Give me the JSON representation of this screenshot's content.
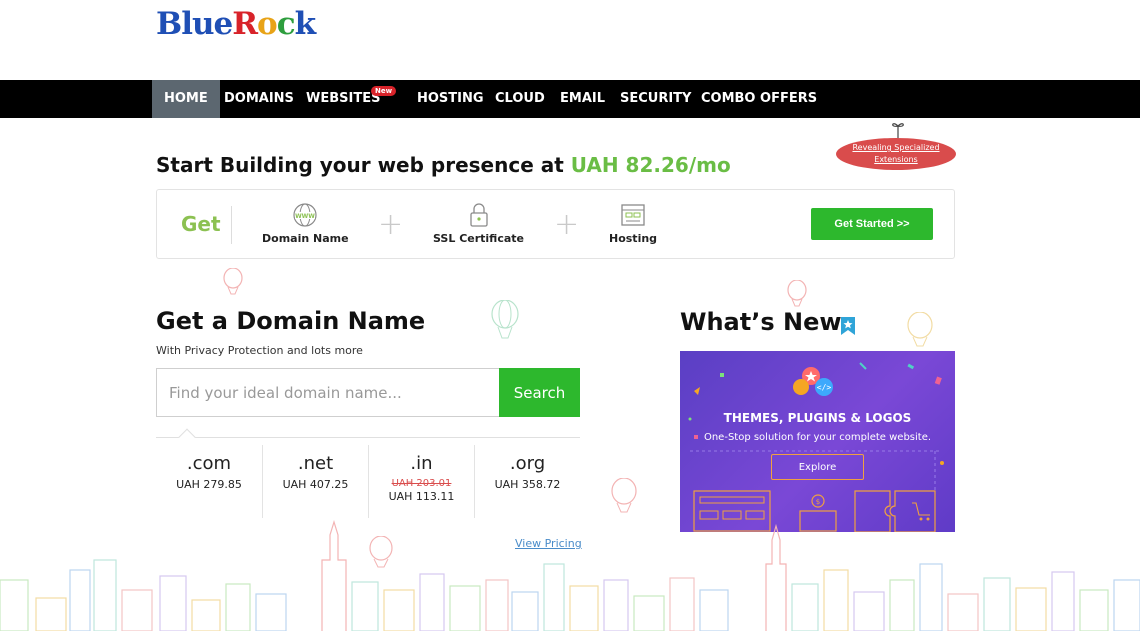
{
  "brand": {
    "logo_letters": [
      "B",
      "l",
      "u",
      "e",
      "R",
      "o",
      "c",
      "k"
    ],
    "logo_colors": [
      "#1f4fb5",
      "#1f4fb5",
      "#1f4fb5",
      "#1f4fb5",
      "#d8232a",
      "#e8a317",
      "#2e9e3e",
      "#1f4fb5"
    ]
  },
  "nav": {
    "items": [
      "HOME",
      "DOMAINS",
      "WEBSITES",
      "HOSTING",
      "CLOUD",
      "EMAIL",
      "SECURITY",
      "COMBO OFFERS"
    ],
    "active": "HOME",
    "new_badge": "New"
  },
  "promo": {
    "headline_prefix": "Start Building your web presence at ",
    "headline_price": "UAH 82.26/mo",
    "extensions_tag": "Revealing Specialized Extensions"
  },
  "getbar": {
    "label": "Get",
    "items": [
      "Domain Name",
      "SSL Certificate",
      "Hosting"
    ],
    "cta": "Get Started >>"
  },
  "domain": {
    "title": "Get a Domain Name",
    "subtitle": "With Privacy Protection and lots more",
    "placeholder": "Find your ideal domain name...",
    "search_label": "Search",
    "tlds": [
      {
        "name": ".com",
        "price": "UAH 279.85"
      },
      {
        "name": ".net",
        "price": "UAH 407.25"
      },
      {
        "name": ".in",
        "old_price": "UAH 203.01",
        "price": "UAH 113.11"
      },
      {
        "name": ".org",
        "price": "UAH 358.72"
      }
    ],
    "view_pricing": "View Pricing"
  },
  "whats_new": {
    "title": "What’s New",
    "banner_heading": "THEMES, PLUGINS & LOGOS",
    "banner_sub": "One-Stop solution for your complete website.",
    "explore_label": "Explore"
  },
  "colors": {
    "accent_green": "#2db82d",
    "price_green": "#6abd45",
    "nav_black": "#000000",
    "nav_active": "#5c6770",
    "banner_purple": "#6a44cf"
  }
}
